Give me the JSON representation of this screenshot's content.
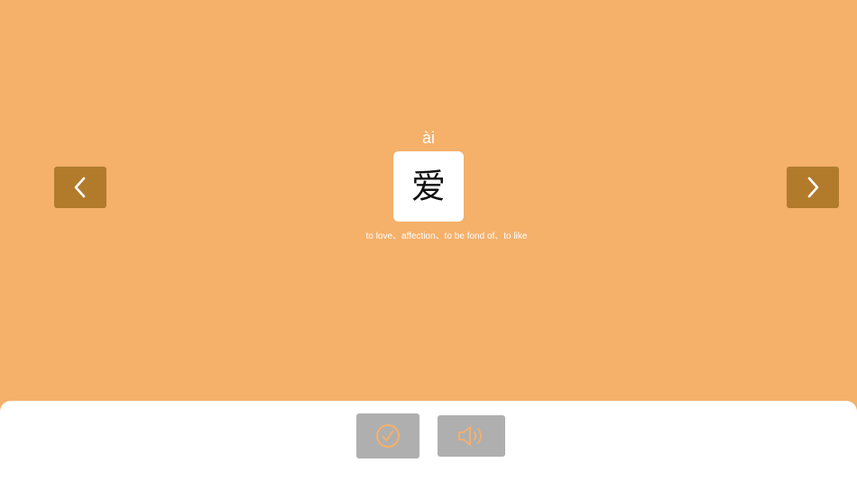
{
  "card": {
    "pinyin": "ài",
    "character": "爱",
    "meaning": "to love、affection、to be fond of、to like"
  },
  "navigation": {
    "prev_icon": "chevron-left-icon",
    "next_icon": "chevron-right-icon"
  },
  "actions": {
    "check_icon": "check-circle-icon",
    "sound_icon": "speaker-icon"
  },
  "colors": {
    "background": "#F5B06A",
    "nav_button": "#B27B2C",
    "action_button": "#AFAFAF",
    "icon_accent": "#F5B06A",
    "panel": "#FFFFFF"
  }
}
